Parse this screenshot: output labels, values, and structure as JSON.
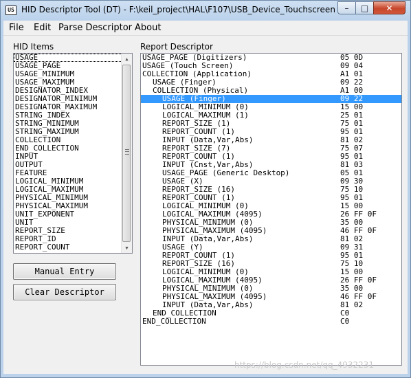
{
  "window": {
    "title": "HID Descriptor Tool (DT) - F:\\keil_project\\HAL\\F107\\USB_Device_Touchscreen...",
    "icon_text": "US"
  },
  "titlebar_buttons": {
    "minimize": "–",
    "maximize": "□",
    "close": "✕"
  },
  "menu": [
    "File",
    "Edit",
    "Parse Descriptor",
    "About"
  ],
  "hid_items": {
    "label": "HID Items",
    "items": [
      "USAGE",
      "USAGE_PAGE",
      "USAGE_MINIMUM",
      "USAGE_MAXIMUM",
      "DESIGNATOR_INDEX",
      "DESIGNATOR_MINIMUM",
      "DESIGNATOR_MAXIMUM",
      "STRING_INDEX",
      "STRING_MINIMUM",
      "STRING_MAXIMUM",
      "COLLECTION",
      "END_COLLECTION",
      "INPUT",
      "OUTPUT",
      "FEATURE",
      "LOGICAL_MINIMUM",
      "LOGICAL_MAXIMUM",
      "PHYSICAL_MINIMUM",
      "PHYSICAL_MAXIMUM",
      "UNIT_EXPONENT",
      "UNIT",
      "REPORT_SIZE",
      "REPORT_ID",
      "REPORT_COUNT"
    ],
    "scroll_up": "▲",
    "scroll_down": "▼"
  },
  "buttons": {
    "manual_entry": "Manual Entry",
    "clear_descriptor": "Clear Descriptor"
  },
  "report_descriptor": {
    "label": "Report Descriptor",
    "rows": [
      {
        "item": "USAGE_PAGE (Digitizers)",
        "hex": "05 0D",
        "indent": 0
      },
      {
        "item": "USAGE (Touch Screen)",
        "hex": "09 04",
        "indent": 0
      },
      {
        "item": "COLLECTION (Application)",
        "hex": "A1 01",
        "indent": 0
      },
      {
        "item": "USAGE (Finger)",
        "hex": "09 22",
        "indent": 1
      },
      {
        "item": "COLLECTION (Physical)",
        "hex": "A1 00",
        "indent": 1
      },
      {
        "item": "USAGE (Finger)",
        "hex": "09 22",
        "indent": 2,
        "selected": true
      },
      {
        "item": "LOGICAL_MINIMUM (0)",
        "hex": "15 00",
        "indent": 2
      },
      {
        "item": "LOGICAL_MAXIMUM (1)",
        "hex": "25 01",
        "indent": 2
      },
      {
        "item": "REPORT_SIZE (1)",
        "hex": "75 01",
        "indent": 2
      },
      {
        "item": "REPORT_COUNT (1)",
        "hex": "95 01",
        "indent": 2
      },
      {
        "item": "INPUT (Data,Var,Abs)",
        "hex": "81 02",
        "indent": 2
      },
      {
        "item": "REPORT_SIZE (7)",
        "hex": "75 07",
        "indent": 2
      },
      {
        "item": "REPORT_COUNT (1)",
        "hex": "95 01",
        "indent": 2
      },
      {
        "item": "INPUT (Cnst,Var,Abs)",
        "hex": "81 03",
        "indent": 2
      },
      {
        "item": "USAGE_PAGE (Generic Desktop)",
        "hex": "05 01",
        "indent": 2
      },
      {
        "item": "USAGE (X)",
        "hex": "09 30",
        "indent": 2
      },
      {
        "item": "REPORT_SIZE (16)",
        "hex": "75 10",
        "indent": 2
      },
      {
        "item": "REPORT_COUNT (1)",
        "hex": "95 01",
        "indent": 2
      },
      {
        "item": "LOGICAL_MINIMUM (0)",
        "hex": "15 00",
        "indent": 2
      },
      {
        "item": "LOGICAL_MAXIMUM (4095)",
        "hex": "26 FF 0F",
        "indent": 2
      },
      {
        "item": "PHYSICAL_MINIMUM (0)",
        "hex": "35 00",
        "indent": 2
      },
      {
        "item": "PHYSICAL_MAXIMUM (4095)",
        "hex": "46 FF 0F",
        "indent": 2
      },
      {
        "item": "INPUT (Data,Var,Abs)",
        "hex": "81 02",
        "indent": 2
      },
      {
        "item": "USAGE (Y)",
        "hex": "09 31",
        "indent": 2
      },
      {
        "item": "REPORT_COUNT (1)",
        "hex": "95 01",
        "indent": 2
      },
      {
        "item": "REPORT_SIZE (16)",
        "hex": "75 10",
        "indent": 2
      },
      {
        "item": "LOGICAL_MINIMUM (0)",
        "hex": "15 00",
        "indent": 2
      },
      {
        "item": "LOGICAL_MAXIMUM (4095)",
        "hex": "26 FF 0F",
        "indent": 2
      },
      {
        "item": "PHYSICAL_MINIMUM (0)",
        "hex": "35 00",
        "indent": 2
      },
      {
        "item": "PHYSICAL_MAXIMUM (4095)",
        "hex": "46 FF 0F",
        "indent": 2
      },
      {
        "item": "INPUT (Data,Var,Abs)",
        "hex": "81 02",
        "indent": 2
      },
      {
        "item": "END_COLLECTION",
        "hex": "C0",
        "indent": 1
      },
      {
        "item": "END_COLLECTION",
        "hex": "C0",
        "indent": 0
      }
    ]
  },
  "watermark": "https://blog.csdn.net/qq_4932231",
  "colors": {
    "selection": "#3399ff",
    "titlebar": "#b9d1ea",
    "close_button": "#c7462b"
  }
}
